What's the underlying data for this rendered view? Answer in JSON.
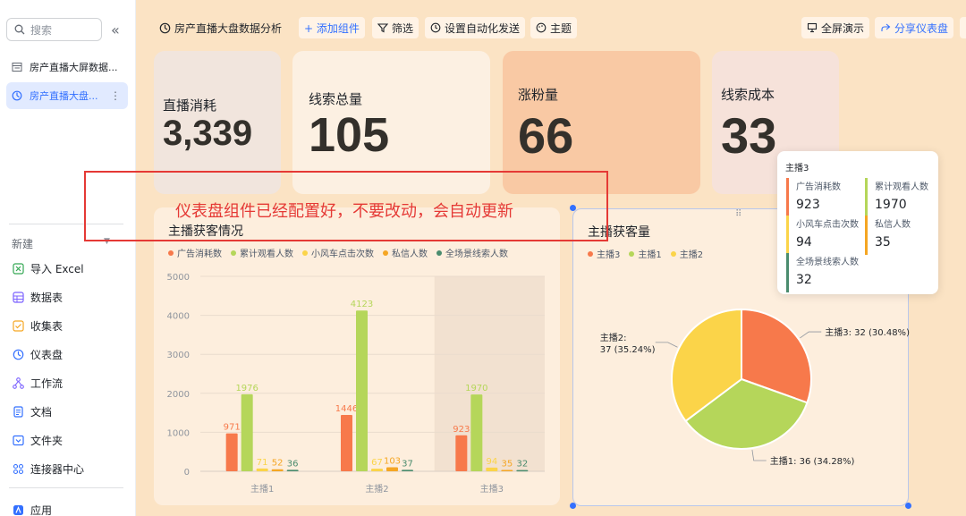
{
  "sidebar": {
    "search_placeholder": "搜索",
    "collapse_icon": "«",
    "docs": [
      {
        "label": "房产直播大屏数据...",
        "icon": "table-icon"
      },
      {
        "label": "房产直播大盘...",
        "icon": "dashboard-icon",
        "active": true
      }
    ],
    "new_label": "新建",
    "nav": [
      {
        "label": "导入 Excel",
        "icon": "excel-icon",
        "color": "#34a853"
      },
      {
        "label": "数据表",
        "icon": "table-icon",
        "color": "#7b61ff"
      },
      {
        "label": "收集表",
        "icon": "form-icon",
        "color": "#f5a623"
      },
      {
        "label": "仪表盘",
        "icon": "dashboard-icon",
        "color": "#3370ff"
      },
      {
        "label": "工作流",
        "icon": "workflow-icon",
        "color": "#7b61ff"
      },
      {
        "label": "文档",
        "icon": "doc-icon",
        "color": "#3370ff"
      },
      {
        "label": "文件夹",
        "icon": "folder-icon",
        "color": "#3370ff"
      },
      {
        "label": "连接器中心",
        "icon": "connector-icon",
        "color": "#3370ff"
      },
      {
        "label": "应用",
        "icon": "app-icon",
        "color": "#3370ff"
      }
    ]
  },
  "toolbar": {
    "title": "房产直播大盘数据分析",
    "add_component": "+ 添加组件",
    "filter": "筛选",
    "auto_send": "设置自动化发送",
    "theme": "主题",
    "fullscreen": "全屏演示",
    "share": "分享仪表盘"
  },
  "kpis": [
    {
      "label": "直播消耗",
      "value": "3,339"
    },
    {
      "label": "线索总量",
      "value": "105"
    },
    {
      "label": "涨粉量",
      "value": "66"
    },
    {
      "label": "线索成本",
      "value": "33"
    }
  ],
  "annotation": "仪表盘组件已经配置好，不要改动，会自动更新",
  "bar_card": {
    "title": "主播获客情况",
    "legend": [
      "广告消耗数",
      "累计观看人数",
      "小风车点击次数",
      "私信人数",
      "全场景线索人数"
    ]
  },
  "pie_card": {
    "title": "主播获客量",
    "legend": [
      "主播3",
      "主播1",
      "主播2"
    ]
  },
  "tooltip": {
    "title": "主播3",
    "items": [
      {
        "name": "广告消耗数",
        "value": "923",
        "color": "#f7794b"
      },
      {
        "name": "累计观看人数",
        "value": "1970",
        "color": "#b5d65a"
      },
      {
        "name": "小风车点击次数",
        "value": "94",
        "color": "#fbd449"
      },
      {
        "name": "私信人数",
        "value": "35",
        "color": "#f5a623"
      },
      {
        "name": "全场景线索人数",
        "value": "32",
        "color": "#4a8c6e"
      }
    ]
  },
  "chart_data": [
    {
      "type": "bar",
      "title": "主播获客情况",
      "categories": [
        "主播1",
        "主播2",
        "主播3"
      ],
      "ylim": [
        0,
        5000
      ],
      "yticks": [
        0,
        1000,
        2000,
        3000,
        4000,
        5000
      ],
      "grid": true,
      "legend_position": "top-left",
      "series": [
        {
          "name": "广告消耗数",
          "values": [
            971,
            1446,
            923
          ],
          "color": "#f7794b"
        },
        {
          "name": "累计观看人数",
          "values": [
            1976,
            4123,
            1970
          ],
          "color": "#b5d65a"
        },
        {
          "name": "小风车点击次数",
          "values": [
            71,
            67,
            94
          ],
          "color": "#fbd449"
        },
        {
          "name": "私信人数",
          "values": [
            52,
            103,
            35
          ],
          "color": "#f5a623"
        },
        {
          "name": "全场景线索人数",
          "values": [
            36,
            37,
            32
          ],
          "color": "#4a8c6e"
        }
      ]
    },
    {
      "type": "pie",
      "title": "主播获客量",
      "legend_position": "top-left",
      "slices": [
        {
          "name": "主播3",
          "value": 32,
          "label": "主播3: 32 (30.48%)",
          "color": "#f7794b"
        },
        {
          "name": "主播1",
          "value": 36,
          "label": "主播1: 36 (34.28%)",
          "color": "#b5d65a"
        },
        {
          "name": "主播2",
          "value": 37,
          "label": "主播2:\n37 (35.24%)",
          "color": "#fbd449"
        }
      ]
    }
  ]
}
